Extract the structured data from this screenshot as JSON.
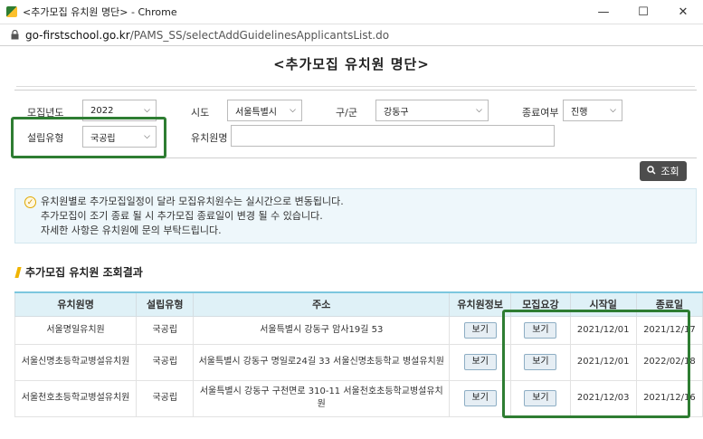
{
  "browser": {
    "title": "<추가모집 유치원 명단> - Chrome",
    "url_host": "go-firstschool.go.kr",
    "url_path": "/PAMS_SS/selectAddGuidelinesApplicantsList.do"
  },
  "page": {
    "title": "<추가모집 유치원 명단>"
  },
  "filters": {
    "year_label": "모집년도",
    "year_value": "2022",
    "sido_label": "시도",
    "sido_value": "서울특별시",
    "gugun_label": "구/군",
    "gugun_value": "강동구",
    "status_label": "종료여부",
    "status_value": "진행",
    "type_label": "설립유형",
    "type_value": "국공립",
    "name_label": "유치원명",
    "name_value": "",
    "search_label": "조회"
  },
  "notice": {
    "lines": [
      "유치원별로 추가모집일정이 달라 모집유치원수는 실시간으로 변동됩니다.",
      "추가모집이 조기 종료 될 시 추가모집 종료일이 변경 될 수 있습니다.",
      "자세한 사항은 유치원에 문의 부탁드립니다."
    ]
  },
  "results": {
    "section_title": "추가모집 유치원 조회결과",
    "columns": [
      "유치원명",
      "설립유형",
      "주소",
      "유치원정보",
      "모집요강",
      "시작일",
      "종료일"
    ],
    "view_label": "보기",
    "rows": [
      {
        "name": "서울명일유치원",
        "type": "국공립",
        "address": "서울특별시 강동구 암사19길 53",
        "start": "2021/12/01",
        "end": "2021/12/17"
      },
      {
        "name": "서울신명초등학교병설유치원",
        "type": "국공립",
        "address": "서울특별시 강동구 명일로24길 33 서울신명초등학교 병설유치원",
        "start": "2021/12/01",
        "end": "2022/02/18"
      },
      {
        "name": "서울천호초등학교병설유치원",
        "type": "국공립",
        "address": "서울특별시 강동구 구천면로 310-11 서울천호초등학교병설유치원",
        "start": "2021/12/03",
        "end": "2021/12/16"
      }
    ]
  },
  "icons": {
    "favicon": "site-favicon",
    "lock": "lock-icon",
    "search": "search-icon",
    "notice": "check-circle-icon"
  },
  "colors": {
    "highlight": "#2e7d32",
    "table_header": "#dff1f7",
    "notice_bg": "#eef7fb",
    "search_button": "#4d4d4d"
  }
}
